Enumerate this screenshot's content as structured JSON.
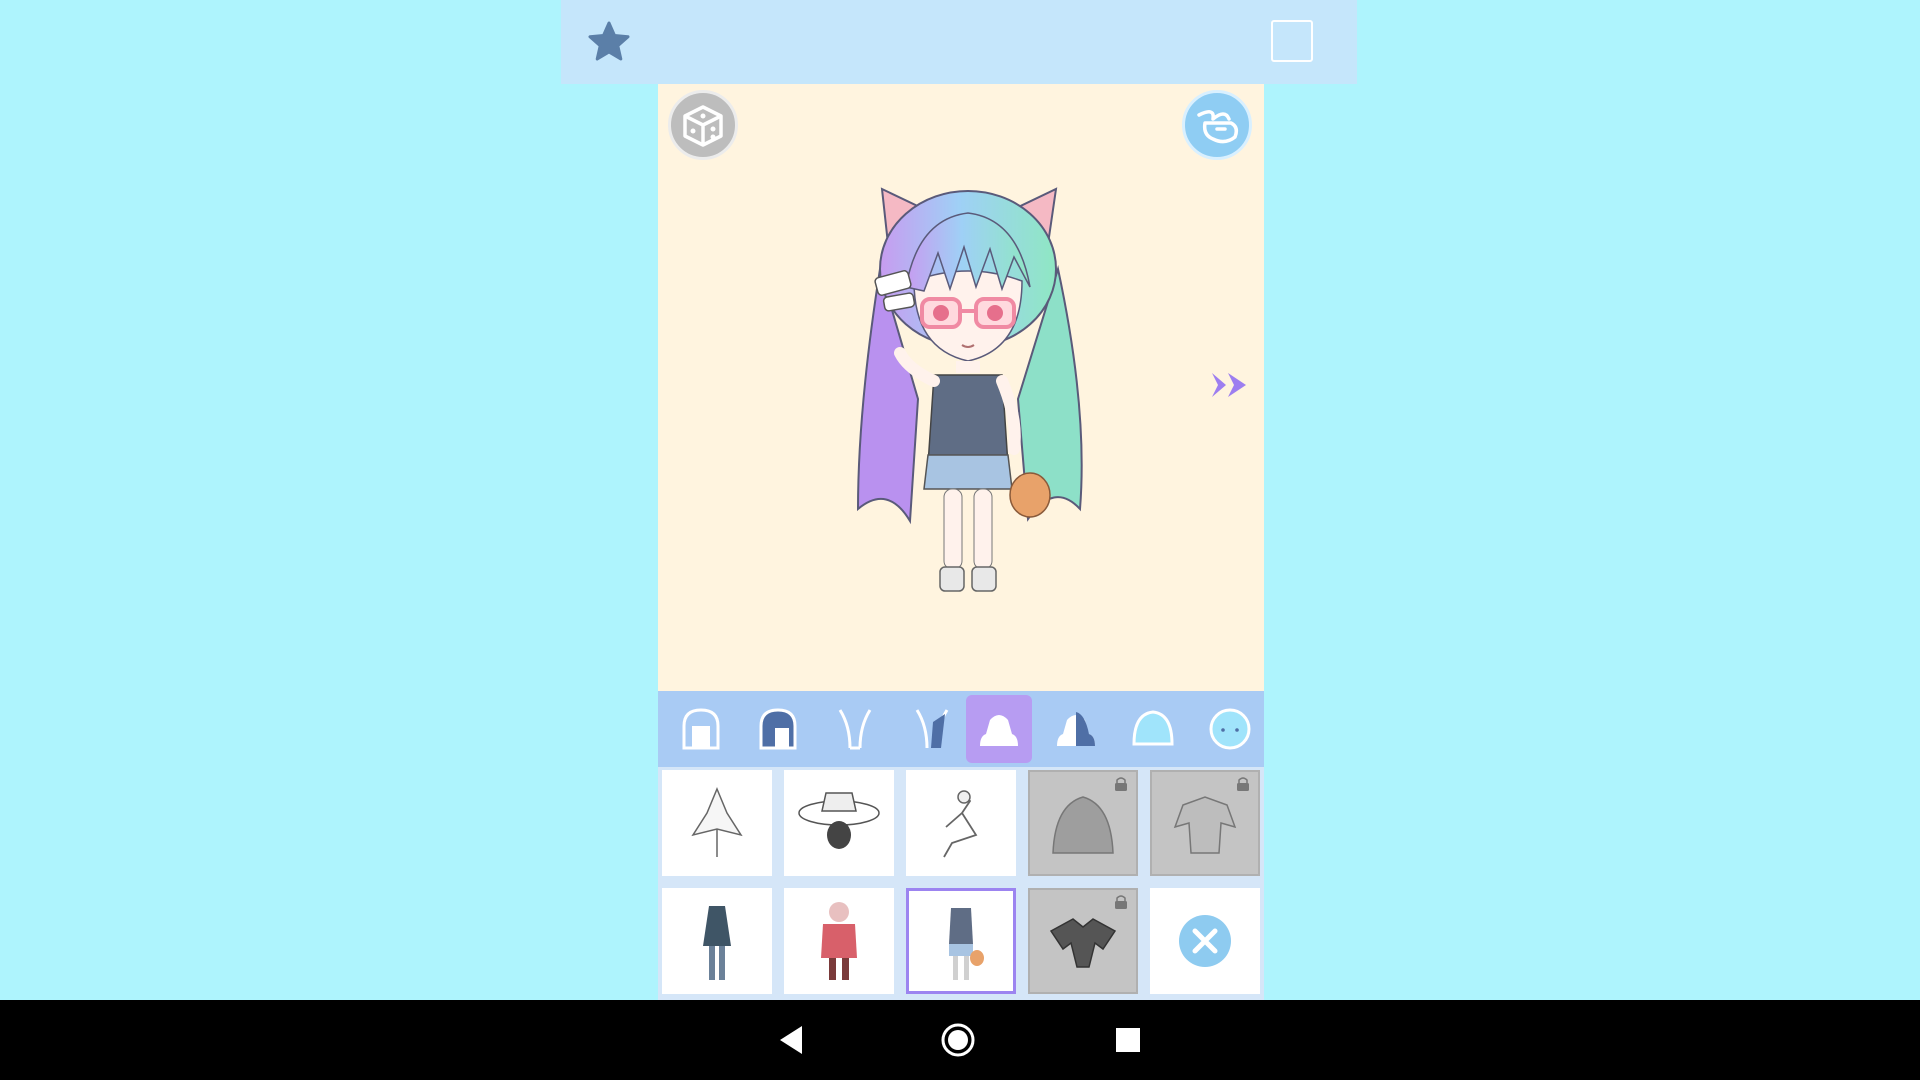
{
  "toolbar": {
    "favorite_icon": "star-icon",
    "page_icon": "blank-page-icon"
  },
  "stage": {
    "random_icon": "dice-icon",
    "bunny_icon": "bunny-icon",
    "next_icon": "double-chevron-right-icon",
    "background_color": "#fff4df"
  },
  "tabs": [
    {
      "icon": "back-hair-icon",
      "selected": false
    },
    {
      "icon": "front-hair-icon",
      "selected": false
    },
    {
      "icon": "ears-icon",
      "selected": false
    },
    {
      "icon": "ears-alt-icon",
      "selected": false
    },
    {
      "icon": "outfit-icon",
      "selected": true
    },
    {
      "icon": "outfit-alt-icon",
      "selected": false
    },
    {
      "icon": "body-icon",
      "selected": false
    },
    {
      "icon": "face-icon",
      "selected": false
    }
  ],
  "items": [
    {
      "icon": "outfit-dress-icon",
      "locked": false,
      "selected": false
    },
    {
      "icon": "outfit-hat-icon",
      "locked": false,
      "selected": false
    },
    {
      "icon": "outfit-ribbon-icon",
      "locked": false,
      "selected": false
    },
    {
      "icon": "outfit-hood-icon",
      "locked": true,
      "selected": false
    },
    {
      "icon": "outfit-jacket-icon",
      "locked": true,
      "selected": false
    },
    {
      "icon": "outfit-dark-dress-icon",
      "locked": false,
      "selected": false
    },
    {
      "icon": "outfit-red-coat-icon",
      "locked": false,
      "selected": false
    },
    {
      "icon": "outfit-tank-shorts-icon",
      "locked": false,
      "selected": true
    },
    {
      "icon": "outfit-cape-icon",
      "locked": true,
      "selected": false
    },
    {
      "icon": "remove-icon",
      "locked": false,
      "selected": false
    }
  ],
  "colors": {
    "background": "#aef4fd",
    "toolbar": "#c5e6fb",
    "tab_bar": "#a9cbf4",
    "selected_tab": "#b79cf2",
    "accent_purple": "#9c84f0",
    "remove_button": "#8ecbf0"
  }
}
